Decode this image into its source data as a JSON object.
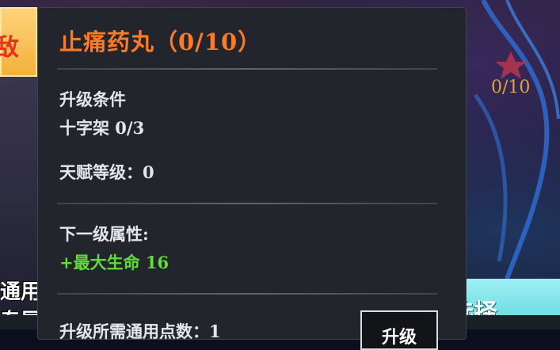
{
  "tooltip": {
    "title": "止痛药丸（0/10）",
    "condition_heading": "升级条件",
    "condition_item": "十字架 0/3",
    "talent_level": "天赋等级：0",
    "next_level_heading": "下一级属性:",
    "next_level_attr": "+最大生命 16",
    "cost_text": "升级所需通用点数：1",
    "upgrade_button": "升级"
  },
  "background": {
    "left_tab_text": "敌",
    "left_label_1": "通用",
    "left_label_2": "专属",
    "right_progress": "0/10",
    "right_button": "选择"
  },
  "colors": {
    "title": "#ff7a22",
    "attribute_bonus": "#5fdc37",
    "progress": "#e3a23c"
  }
}
